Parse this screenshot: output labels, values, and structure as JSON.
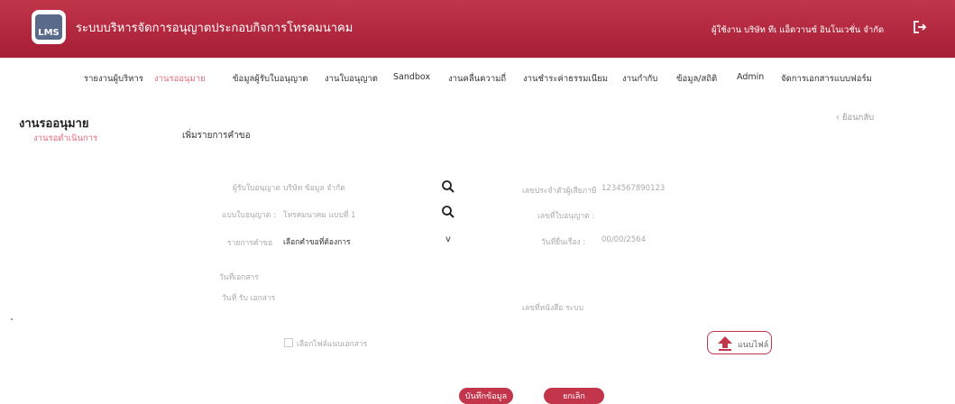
{
  "header": {
    "logo_text": "LMS",
    "app_title": "ระบบบริหารจัดการอนุญาตประกอบกิจการโทรคมนาคม",
    "user": "ผู้ใช้งาน บริษัท ทีเ แอ็ดวานซ์ อินโนเวชั่น จำกัด",
    "accent_color": "#b0263d",
    "icons": [
      "logout-icon"
    ]
  },
  "nav": {
    "items": [
      "รายงานผู้บริหาร",
      "งานรออนุมาย",
      "ข้อมูลผู้รับใบอนุญาต",
      "งานใบอนุญาต",
      "Sandbox",
      "งานคลื่นความถี่",
      "งานชำระค่าธรรมเนียม",
      "งานกำกับ",
      "ข้อมูล/สถิติ",
      "Admin",
      "จัดการเอกสารแบบฟอร์ม"
    ],
    "active_index": 1
  },
  "page": {
    "title": "งานรออนุมาย",
    "sub": "งานรอดำเนินการ",
    "section": "เพิ่มรายการคำขอ",
    "back": "ย้อนกลับ"
  },
  "form": {
    "licensee_label": "ผู้รับใบอนุญาต",
    "licensee_value": "บริษัท ข้อมูล จำกัด",
    "license_type_label": "แบบใบอนุญาต :",
    "license_type_value": "โทรคมนาคม แบบที่ 1",
    "request_type_label": "รายการคำขอ",
    "request_type_value": "เลือกคำขอที่ต้องการ",
    "doc_date_label": "วันที่เอกสาร",
    "received_date_label": "วันที่ รับ เอกสาร",
    "tax_id_label": "เลขประจำตัวผู้เสียภาษี",
    "tax_id_value": "1234567890123",
    "license_no_label": "เลขที่ใบอนุญาต :",
    "submit_date_label": "วันที่ยื่นเรื่อง :",
    "submit_date_value": "00/00/2564",
    "page_no_label": "เลขที่หนังสือ ระบบ",
    "checkbox_label": "เลือกไฟล์แนบเอกสาร",
    "upload_label": "แนบไฟล์",
    "dropdown_symbol": "v"
  },
  "actions": {
    "save": "บันทึกข้อมูล",
    "cancel": "ยกเลิก"
  },
  "icons": [
    "search-icon",
    "search-icon",
    "upload-icon",
    "chevron-left-icon",
    "logout-icon"
  ]
}
